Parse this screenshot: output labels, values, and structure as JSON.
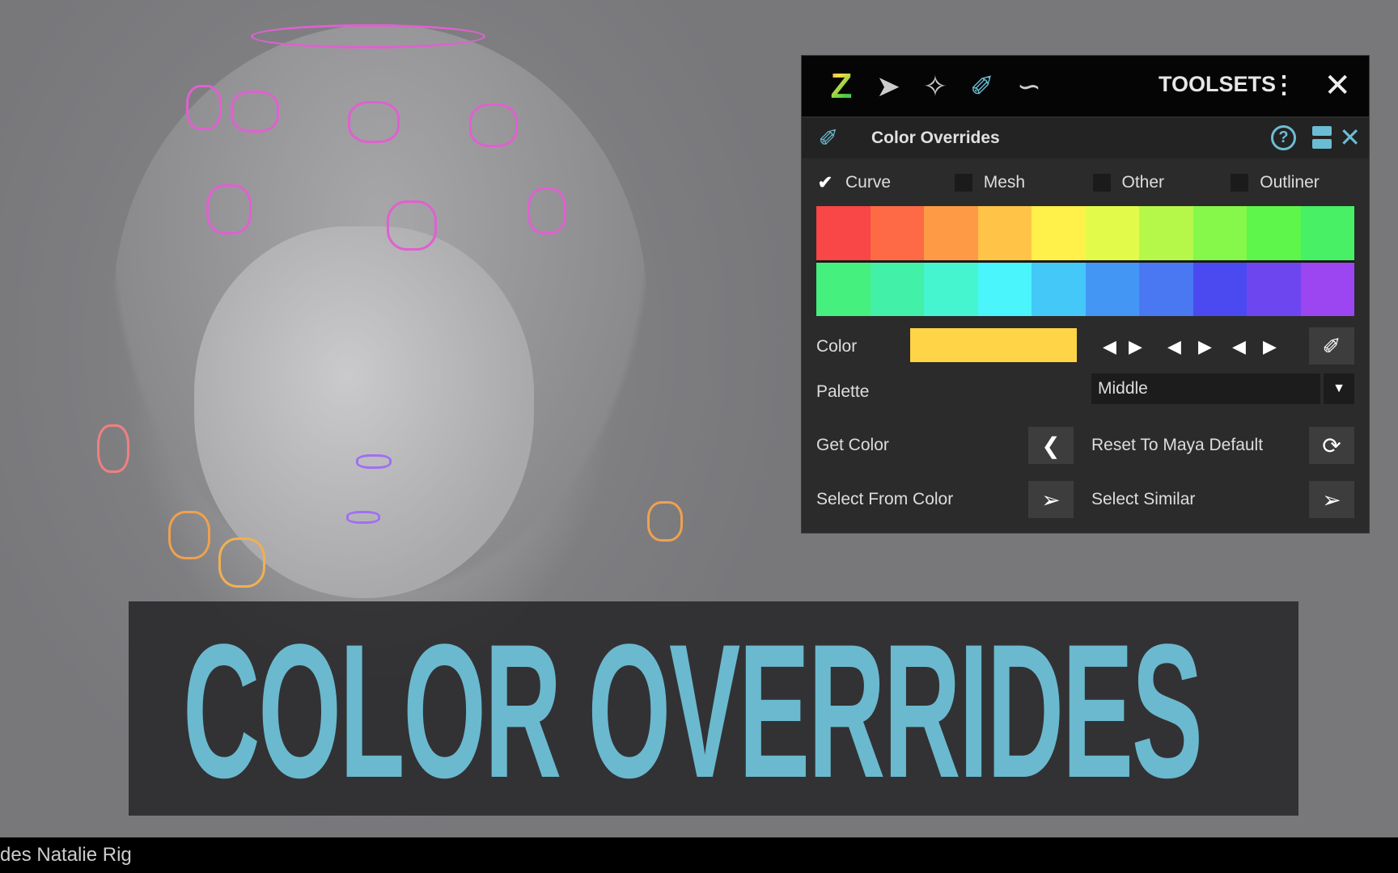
{
  "toolbar": {
    "title": "TOOLSETS",
    "icons": [
      "zoo-logo-icon",
      "rocket-icon",
      "star-icon",
      "paint-brush-icon",
      "curve-icon",
      "kebab-menu-icon",
      "close-icon"
    ]
  },
  "panel": {
    "title": "Color Overrides",
    "checkboxes": [
      {
        "label": "Curve",
        "checked": true
      },
      {
        "label": "Mesh",
        "checked": false
      },
      {
        "label": "Other",
        "checked": false
      },
      {
        "label": "Outliner",
        "checked": false
      }
    ],
    "palette_colors": [
      "#f94646",
      "#fd6a45",
      "#fe9a45",
      "#ffc447",
      "#fff04a",
      "#e2fb4a",
      "#b6f84a",
      "#86f84a",
      "#5ef64b",
      "#47f065",
      "#45f07e",
      "#43f0a8",
      "#45f5cf",
      "#4af5fb",
      "#44c8f8",
      "#4496f5",
      "#4a78f2",
      "#4a4af0",
      "#6e46f0",
      "#9b46f0"
    ],
    "color_label": "Color",
    "color_value": "#ffd447",
    "palette_label": "Palette",
    "palette_value": "Middle",
    "get_color": "Get Color",
    "reset": "Reset To Maya Default",
    "select_from_color": "Select From Color",
    "select_similar": "Select Similar"
  },
  "banner": {
    "text": "COLOR OVERRIDES",
    "color": "#6bb9cf"
  },
  "caption": "des Natalie Rig"
}
